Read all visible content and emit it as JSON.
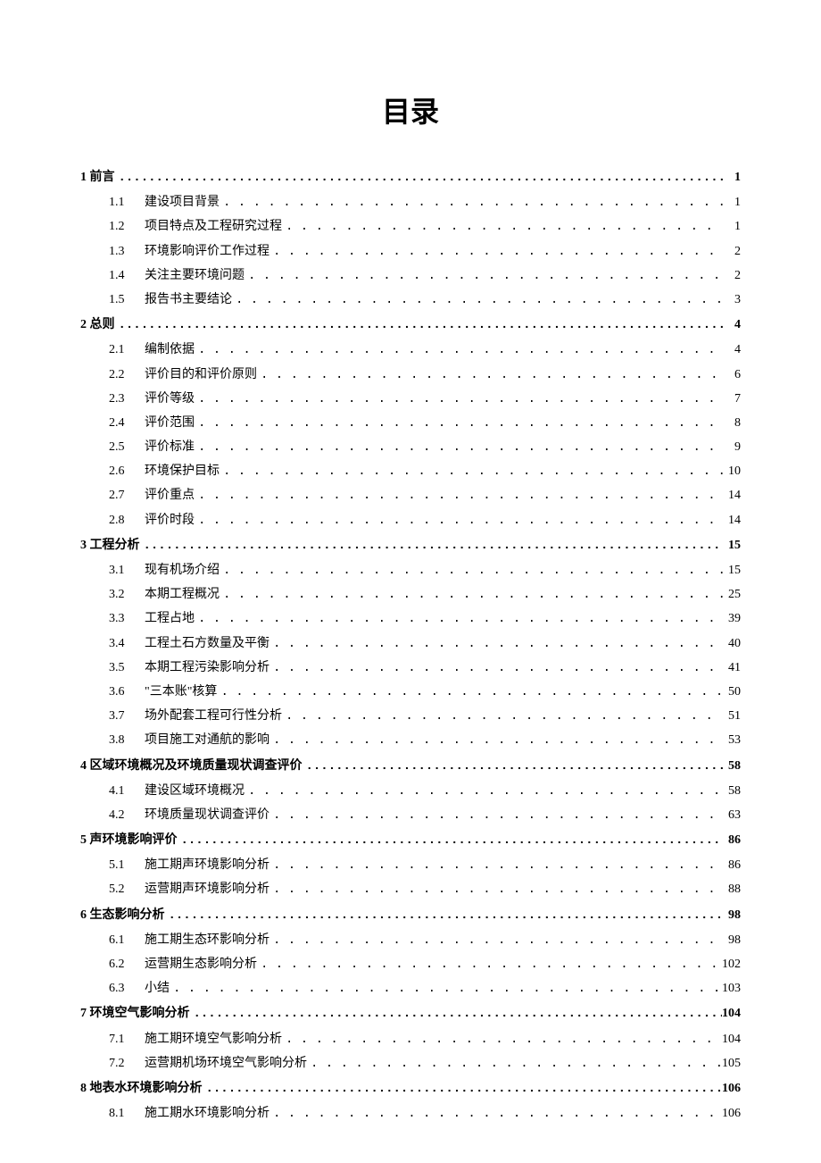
{
  "title": "目录",
  "toc": [
    {
      "type": "chapter",
      "num": "1",
      "text": "前言",
      "page": "1"
    },
    {
      "type": "sub",
      "num": "1.1",
      "text": "建设项目背景",
      "page": "1"
    },
    {
      "type": "sub",
      "num": "1.2",
      "text": "项目特点及工程研究过程",
      "page": "1"
    },
    {
      "type": "sub",
      "num": "1.3",
      "text": "环境影响评价工作过程",
      "page": "2"
    },
    {
      "type": "sub",
      "num": "1.4",
      "text": "关注主要环境问题",
      "page": "2"
    },
    {
      "type": "sub",
      "num": "1.5",
      "text": "报告书主要结论",
      "page": "3"
    },
    {
      "type": "chapter",
      "num": "2",
      "text": "总则",
      "page": "4"
    },
    {
      "type": "sub",
      "num": "2.1",
      "text": "编制依据",
      "page": "4"
    },
    {
      "type": "sub",
      "num": "2.2",
      "text": "评价目的和评价原则",
      "page": "6"
    },
    {
      "type": "sub",
      "num": "2.3",
      "text": "评价等级",
      "page": "7"
    },
    {
      "type": "sub",
      "num": "2.4",
      "text": "评价范围",
      "page": "8"
    },
    {
      "type": "sub",
      "num": "2.5",
      "text": "评价标准",
      "page": "9"
    },
    {
      "type": "sub",
      "num": "2.6",
      "text": "环境保护目标",
      "page": "10"
    },
    {
      "type": "sub",
      "num": "2.7",
      "text": "评价重点",
      "page": "14"
    },
    {
      "type": "sub",
      "num": "2.8",
      "text": "评价时段",
      "page": "14"
    },
    {
      "type": "chapter",
      "num": "3",
      "text": "工程分析",
      "page": "15"
    },
    {
      "type": "sub",
      "num": "3.1",
      "text": "现有机场介绍",
      "page": "15"
    },
    {
      "type": "sub",
      "num": "3.2",
      "text": "本期工程概况",
      "page": "25"
    },
    {
      "type": "sub",
      "num": "3.3",
      "text": "工程占地",
      "page": "39"
    },
    {
      "type": "sub",
      "num": "3.4",
      "text": "工程土石方数量及平衡",
      "page": "40"
    },
    {
      "type": "sub",
      "num": "3.5",
      "text": "本期工程污染影响分析",
      "page": "41"
    },
    {
      "type": "sub",
      "num": "3.6",
      "text": "\"三本账\"核算",
      "page": "50"
    },
    {
      "type": "sub",
      "num": "3.7",
      "text": "场外配套工程可行性分析",
      "page": "51"
    },
    {
      "type": "sub",
      "num": "3.8",
      "text": "项目施工对通航的影响",
      "page": "53"
    },
    {
      "type": "chapter",
      "num": "4",
      "text": "区域环境概况及环境质量现状调查评价",
      "page": "58"
    },
    {
      "type": "sub",
      "num": "4.1",
      "text": "建设区域环境概况",
      "page": "58"
    },
    {
      "type": "sub",
      "num": "4.2",
      "text": "环境质量现状调查评价",
      "page": "63"
    },
    {
      "type": "chapter",
      "num": "5",
      "text": "声环境影响评价",
      "page": "86"
    },
    {
      "type": "sub",
      "num": "5.1",
      "text": "施工期声环境影响分析",
      "page": "86"
    },
    {
      "type": "sub",
      "num": "5.2",
      "text": "运营期声环境影响分析",
      "page": "88"
    },
    {
      "type": "chapter",
      "num": "6",
      "text": "生态影响分析",
      "page": "98"
    },
    {
      "type": "sub",
      "num": "6.1",
      "text": "施工期生态环影响分析",
      "page": "98"
    },
    {
      "type": "sub",
      "num": "6.2",
      "text": "运营期生态影响分析",
      "page": "102"
    },
    {
      "type": "sub",
      "num": "6.3",
      "text": "小结",
      "page": "103"
    },
    {
      "type": "chapter",
      "num": "7",
      "text": "环境空气影响分析",
      "page": "104"
    },
    {
      "type": "sub",
      "num": "7.1",
      "text": "施工期环境空气影响分析",
      "page": "104"
    },
    {
      "type": "sub",
      "num": "7.2",
      "text": "运营期机场环境空气影响分析",
      "page": "105"
    },
    {
      "type": "chapter",
      "num": "8",
      "text": "地表水环境影响分析",
      "page": "106"
    },
    {
      "type": "sub",
      "num": "8.1",
      "text": "施工期水环境影响分析",
      "page": "106"
    }
  ]
}
